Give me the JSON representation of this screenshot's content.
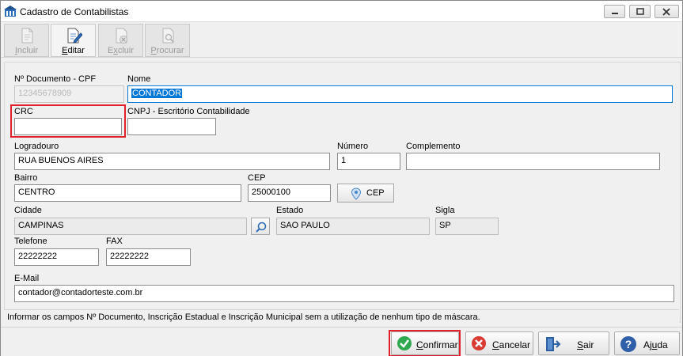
{
  "window": {
    "title": "Cadastro de Contabilistas"
  },
  "toolbar": {
    "incluir": {
      "prefix": "",
      "hot": "I",
      "rest": "ncluir"
    },
    "editar": {
      "prefix": "",
      "hot": "E",
      "rest": "ditar"
    },
    "excluir": {
      "prefix": "E",
      "hot": "x",
      "rest": "cluir"
    },
    "procurar": {
      "prefix": "",
      "hot": "P",
      "rest": "rocurar"
    }
  },
  "form": {
    "doc_label": "Nº Documento - CPF",
    "doc_value": "12345678909",
    "nome_label": "Nome",
    "nome_value": "CONTADOR",
    "crc_label": "CRC",
    "crc_value": "",
    "cnpj_label": "CNPJ - Escritório Contabilidade",
    "cnpj_value": "",
    "logradouro_label": "Logradouro",
    "logradouro_value": "RUA BUENOS AIRES",
    "numero_label": "Número",
    "numero_value": "1",
    "complemento_label": "Complemento",
    "complemento_value": "",
    "bairro_label": "Bairro",
    "bairro_value": "CENTRO",
    "cep_label": "CEP",
    "cep_value": "25000100",
    "cep_button": "CEP",
    "cidade_label": "Cidade",
    "cidade_value": "CAMPINAS",
    "estado_label": "Estado",
    "estado_value": "SAO PAULO",
    "sigla_label": "Sigla",
    "sigla_value": "SP",
    "telefone_label": "Telefone",
    "telefone_value": "22222222",
    "fax_label": "FAX",
    "fax_value": "22222222",
    "email_label": "E-Mail",
    "email_value": "contador@contadorteste.com.br"
  },
  "info_text": "Informar os campos Nº Documento, Inscrição Estadual e Inscrição Municipal sem a utilização de nenhum tipo de máscara.",
  "buttons": {
    "confirmar": {
      "hot": "C",
      "rest": "onfirmar"
    },
    "cancelar": {
      "hot": "C",
      "rest": "ancelar"
    },
    "sair": {
      "hot": "S",
      "rest": "air"
    },
    "ajuda": {
      "prefix": "Aj",
      "hot": "u",
      "rest": "da"
    }
  },
  "colors": {
    "highlight": "#e0202a",
    "selection": "#0078d7"
  }
}
